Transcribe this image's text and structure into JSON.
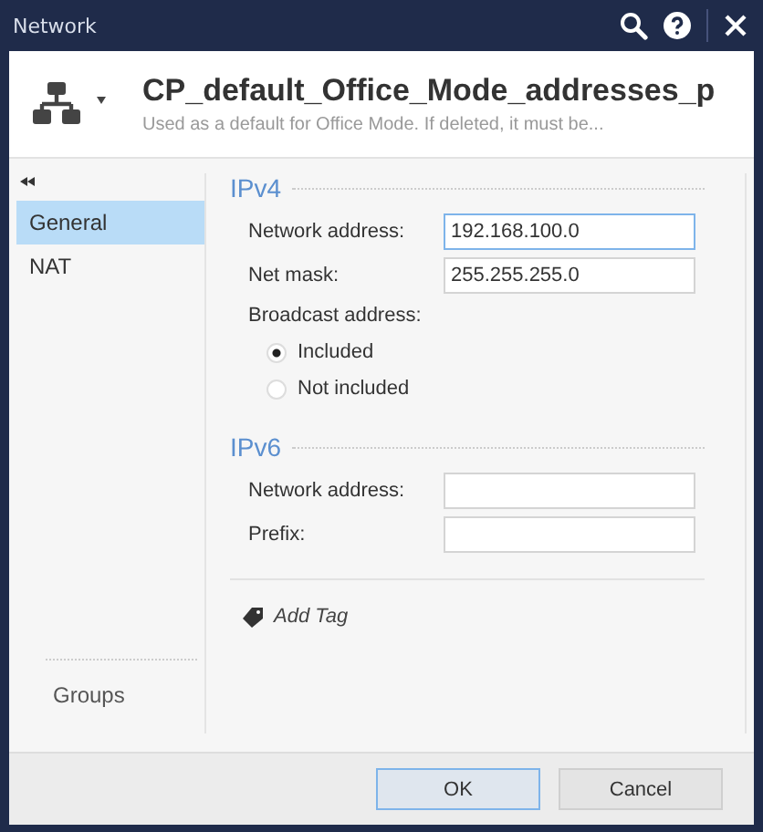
{
  "window": {
    "title": "Network"
  },
  "header": {
    "name": "CP_default_Office_Mode_addresses_p",
    "description": "Used as a default for Office Mode. If deleted, it must be..."
  },
  "sidebar": {
    "items": [
      {
        "label": "General",
        "selected": true
      },
      {
        "label": "NAT",
        "selected": false
      }
    ],
    "bottom_item": "Groups"
  },
  "sections": [
    {
      "title": "IPv4",
      "fields": [
        {
          "label": "Network address:",
          "value": "192.168.100.0",
          "focused": true
        },
        {
          "label": "Net mask:",
          "value": "255.255.255.0",
          "focused": false
        }
      ],
      "radio_group": {
        "label": "Broadcast address:",
        "options": [
          {
            "label": "Included",
            "selected": true
          },
          {
            "label": "Not included",
            "selected": false
          }
        ]
      }
    },
    {
      "title": "IPv6",
      "fields": [
        {
          "label": "Network address:",
          "focused": false
        },
        {
          "label": "Prefix:",
          "focused": false
        }
      ]
    }
  ],
  "add_tag": "Add Tag",
  "buttons": [
    {
      "label": "OK",
      "kind": "default"
    },
    {
      "label": "Cancel",
      "kind": "normal"
    }
  ]
}
